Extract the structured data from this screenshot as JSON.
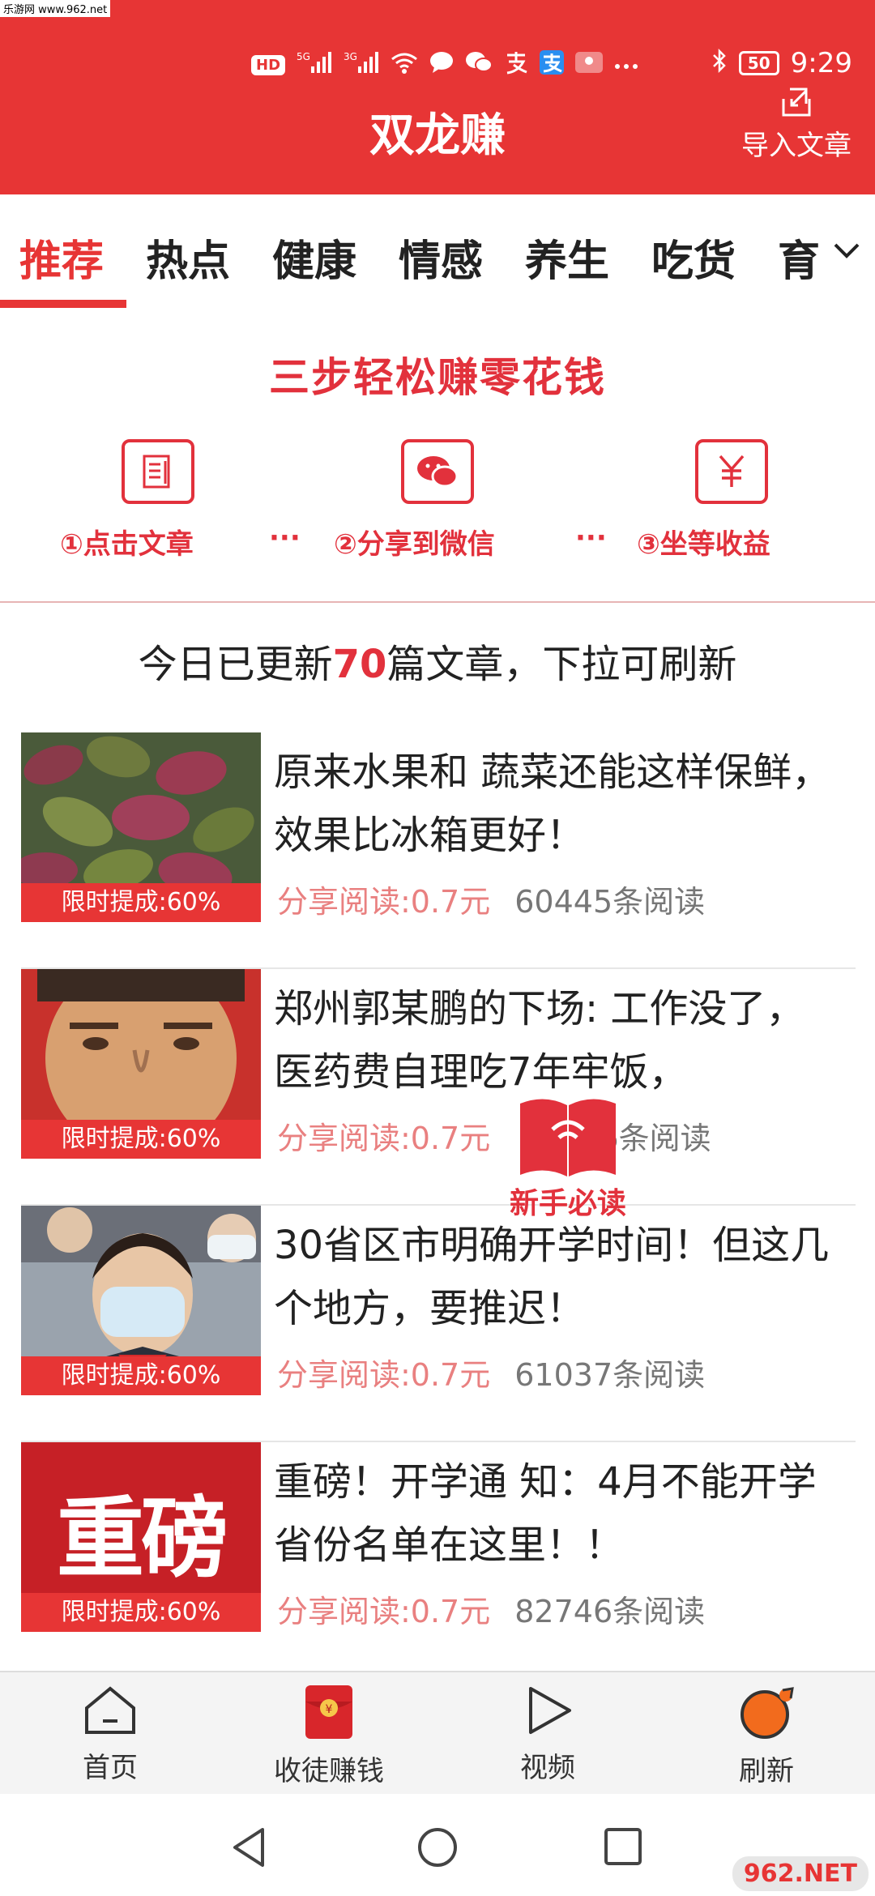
{
  "watermark": "乐游网 www.962.net",
  "status_bar": {
    "network": [
      "HD",
      "5G",
      "3G"
    ],
    "battery": "50",
    "time": "9:29"
  },
  "header": {
    "title": "双龙赚",
    "import_label": "导入文章"
  },
  "tabs": [
    "推荐",
    "热点",
    "健康",
    "情感",
    "养生",
    "吃货",
    "育"
  ],
  "banner": {
    "title": "三步轻松赚零花钱",
    "steps": [
      {
        "icon": "document-icon",
        "label": "①点击文章"
      },
      {
        "icon": "wechat-icon",
        "label": "②分享到微信"
      },
      {
        "icon": "yuan-icon",
        "label": "③坐等收益"
      }
    ],
    "dots": "···"
  },
  "notice": {
    "prefix": "今日已更新",
    "count": "70",
    "suffix": "篇文章，下拉可刷新"
  },
  "articles": [
    {
      "title": "原来水果和 蔬菜还能这样保鲜，效果比冰箱更好！",
      "promo": "限时提成:60%",
      "share": "分享阅读:0.7元",
      "reads": "60445条阅读",
      "thumb": "amaranth-leaves"
    },
    {
      "title": "郑州郭某鹏的下场: 工作没了，医药费自理吃7年牢饭，",
      "promo": "限时提成:60%",
      "share": "分享阅读:0.7元",
      "reads": "36条阅读",
      "thumb": "face-photo"
    },
    {
      "title": "30省区市明确开学时间！但这几个地方，要推迟！",
      "promo": "限时提成:60%",
      "share": "分享阅读:0.7元",
      "reads": "61037条阅读",
      "thumb": "student-mask"
    },
    {
      "title": "重磅！开学通 知：4月不能开学省份名单在这里！！",
      "promo": "限时提成:60%",
      "share": "分享阅读:0.7元",
      "reads": "82746条阅读",
      "thumb_text": "重磅"
    }
  ],
  "newbie_badge": "新手必读",
  "bottom_nav": [
    {
      "label": "首页",
      "icon": "home-icon"
    },
    {
      "label": "收徒赚钱",
      "icon": "red-envelope-icon"
    },
    {
      "label": "视频",
      "icon": "play-icon"
    },
    {
      "label": "刷新",
      "icon": "refresh-icon"
    }
  ],
  "corner_logo": "962.NET",
  "colors": {
    "brand_red": "#e73535",
    "accent_red": "#e2313c",
    "share_pink": "#e98080"
  }
}
